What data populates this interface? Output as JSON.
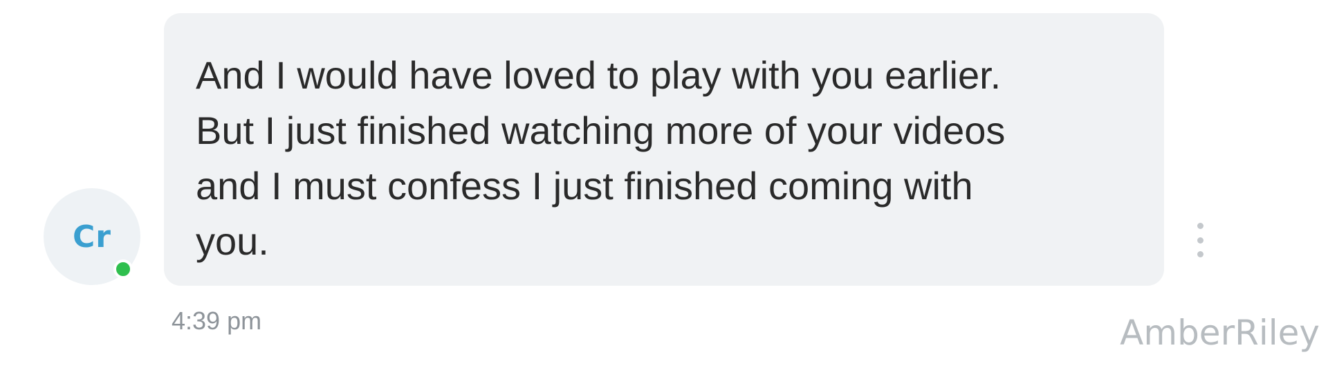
{
  "sender": {
    "initials": "Cr",
    "online": true
  },
  "message": {
    "lines": [
      "And I would have loved to play with you earlier.",
      "But I just finished watching more of your videos",
      "and I must confess I just finished coming with",
      "you."
    ],
    "timestamp": "4:39 pm"
  },
  "actions": {
    "more_icon": "more-vertical-icon"
  },
  "watermark": "AmberRiley",
  "colors": {
    "bubble": "#f0f2f4",
    "avatar_bg": "#eef2f5",
    "initials": "#3a9fd0",
    "online_dot": "#2fbf4e",
    "timestamp": "#8d9399"
  }
}
